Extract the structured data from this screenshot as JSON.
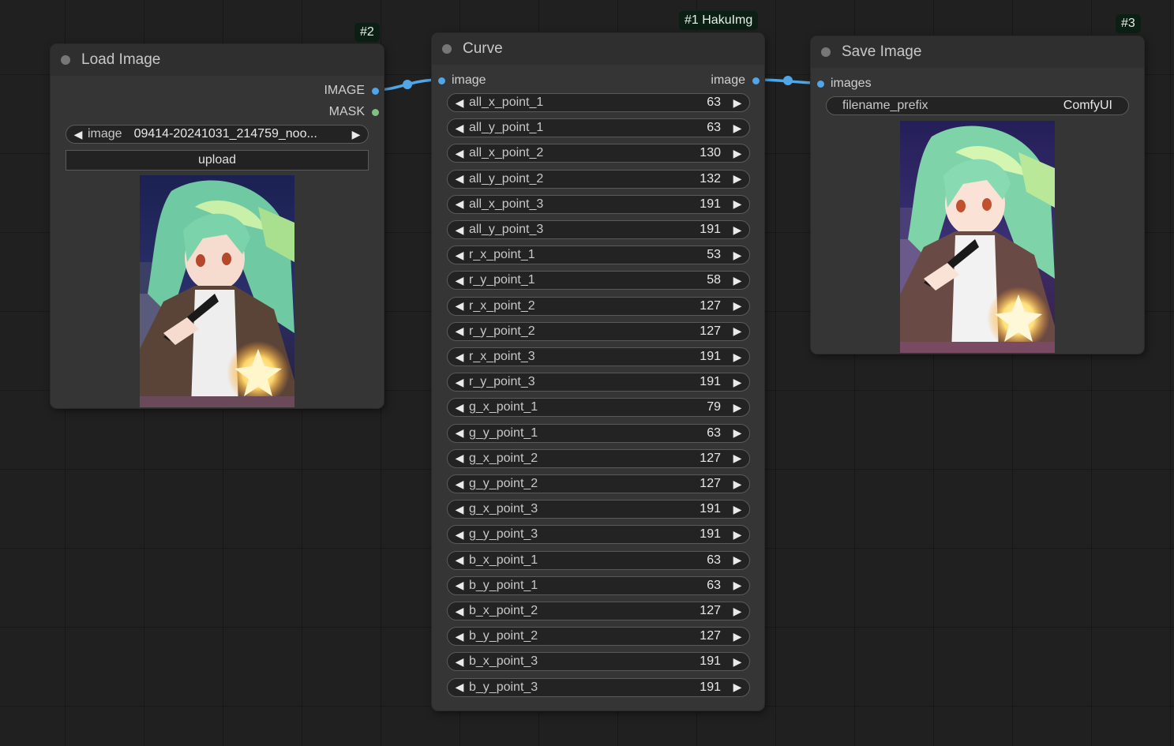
{
  "canvas": {
    "background": "#202020"
  },
  "colors": {
    "image_port": "#4fa6e8",
    "mask_port": "#7fc27f",
    "wire": "#4fa6e8",
    "badge_bg": "#0c1f14"
  },
  "nodes": {
    "load_image": {
      "badge": "#2",
      "title": "Load Image",
      "outputs": [
        {
          "label": "IMAGE",
          "color": "#4fa6e8"
        },
        {
          "label": "MASK",
          "color": "#7fc27f"
        }
      ],
      "image_widget": {
        "label": "image",
        "value": "09414-20241031_214759_noo..."
      },
      "upload_label": "upload"
    },
    "curve": {
      "badge": "#1 HakuImg",
      "title": "Curve",
      "input": "image",
      "output": "image",
      "widgets": [
        {
          "label": "all_x_point_1",
          "value": "63"
        },
        {
          "label": "all_y_point_1",
          "value": "63"
        },
        {
          "label": "all_x_point_2",
          "value": "130"
        },
        {
          "label": "all_y_point_2",
          "value": "132"
        },
        {
          "label": "all_x_point_3",
          "value": "191"
        },
        {
          "label": "all_y_point_3",
          "value": "191"
        },
        {
          "label": "r_x_point_1",
          "value": "53"
        },
        {
          "label": "r_y_point_1",
          "value": "58"
        },
        {
          "label": "r_x_point_2",
          "value": "127"
        },
        {
          "label": "r_y_point_2",
          "value": "127"
        },
        {
          "label": "r_x_point_3",
          "value": "191"
        },
        {
          "label": "r_y_point_3",
          "value": "191"
        },
        {
          "label": "g_x_point_1",
          "value": "79"
        },
        {
          "label": "g_y_point_1",
          "value": "63"
        },
        {
          "label": "g_x_point_2",
          "value": "127"
        },
        {
          "label": "g_y_point_2",
          "value": "127"
        },
        {
          "label": "g_x_point_3",
          "value": "191"
        },
        {
          "label": "g_y_point_3",
          "value": "191"
        },
        {
          "label": "b_x_point_1",
          "value": "63"
        },
        {
          "label": "b_y_point_1",
          "value": "63"
        },
        {
          "label": "b_x_point_2",
          "value": "127"
        },
        {
          "label": "b_y_point_2",
          "value": "127"
        },
        {
          "label": "b_x_point_3",
          "value": "191"
        },
        {
          "label": "b_y_point_3",
          "value": "191"
        }
      ]
    },
    "save_image": {
      "badge": "#3",
      "title": "Save Image",
      "input": "images",
      "filename_widget": {
        "label": "filename_prefix",
        "value": "ComfyUI"
      }
    }
  },
  "icons": {
    "decrement": "left-arrow-icon",
    "increment": "right-arrow-icon",
    "preview": "anime-illustration-thumbnail"
  }
}
